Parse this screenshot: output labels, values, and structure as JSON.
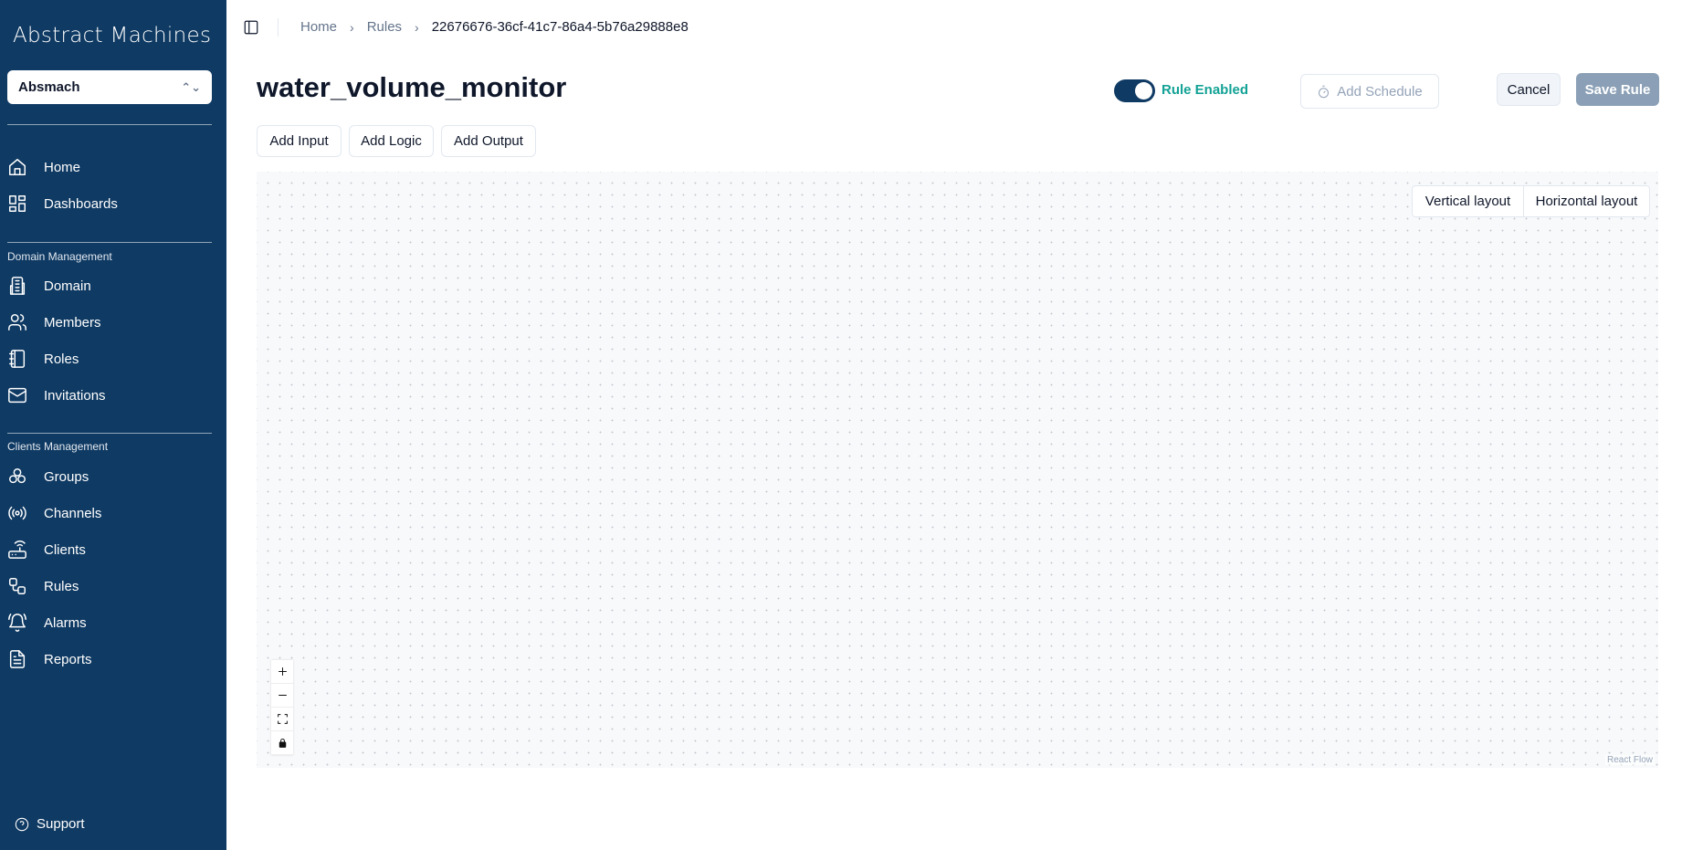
{
  "app": {
    "logo": "Abstract Machines",
    "org_selector": "Absmach"
  },
  "sidebar": {
    "top_items": [
      {
        "label": "Home",
        "icon": "home-icon"
      },
      {
        "label": "Dashboards",
        "icon": "dashboard-icon"
      }
    ],
    "domain_section": {
      "title": "Domain Management",
      "items": [
        {
          "label": "Domain",
          "icon": "building-icon"
        },
        {
          "label": "Members",
          "icon": "users-icon"
        },
        {
          "label": "Roles",
          "icon": "book-icon"
        },
        {
          "label": "Invitations",
          "icon": "mail-icon"
        }
      ]
    },
    "clients_section": {
      "title": "Clients Management",
      "items": [
        {
          "label": "Groups",
          "icon": "boxes-icon"
        },
        {
          "label": "Channels",
          "icon": "radio-icon"
        },
        {
          "label": "Clients",
          "icon": "router-icon"
        },
        {
          "label": "Rules",
          "icon": "workflow-icon"
        },
        {
          "label": "Alarms",
          "icon": "bell-ring-icon"
        },
        {
          "label": "Reports",
          "icon": "file-text-icon"
        }
      ]
    },
    "support": "Support"
  },
  "breadcrumb": {
    "items": [
      "Home",
      "Rules"
    ],
    "current": "22676676-36cf-41c7-86a4-5b76a29888e8"
  },
  "header": {
    "title": "water_volume_monitor",
    "toggle_label": "Rule Enabled",
    "toggle_on": true,
    "schedule_button": "Add Schedule",
    "cancel_button": "Cancel",
    "save_button": "Save Rule"
  },
  "toolbar": {
    "add_input": "Add Input",
    "add_logic": "Add Logic",
    "add_output": "Add Output"
  },
  "canvas": {
    "vertical_layout": "Vertical layout",
    "horizontal_layout": "Horizontal layout",
    "attribution": "React Flow"
  },
  "colors": {
    "sidebar_bg": "#0f3a63",
    "accent_teal": "#13a295",
    "save_disabled": "#8ba0b6"
  }
}
